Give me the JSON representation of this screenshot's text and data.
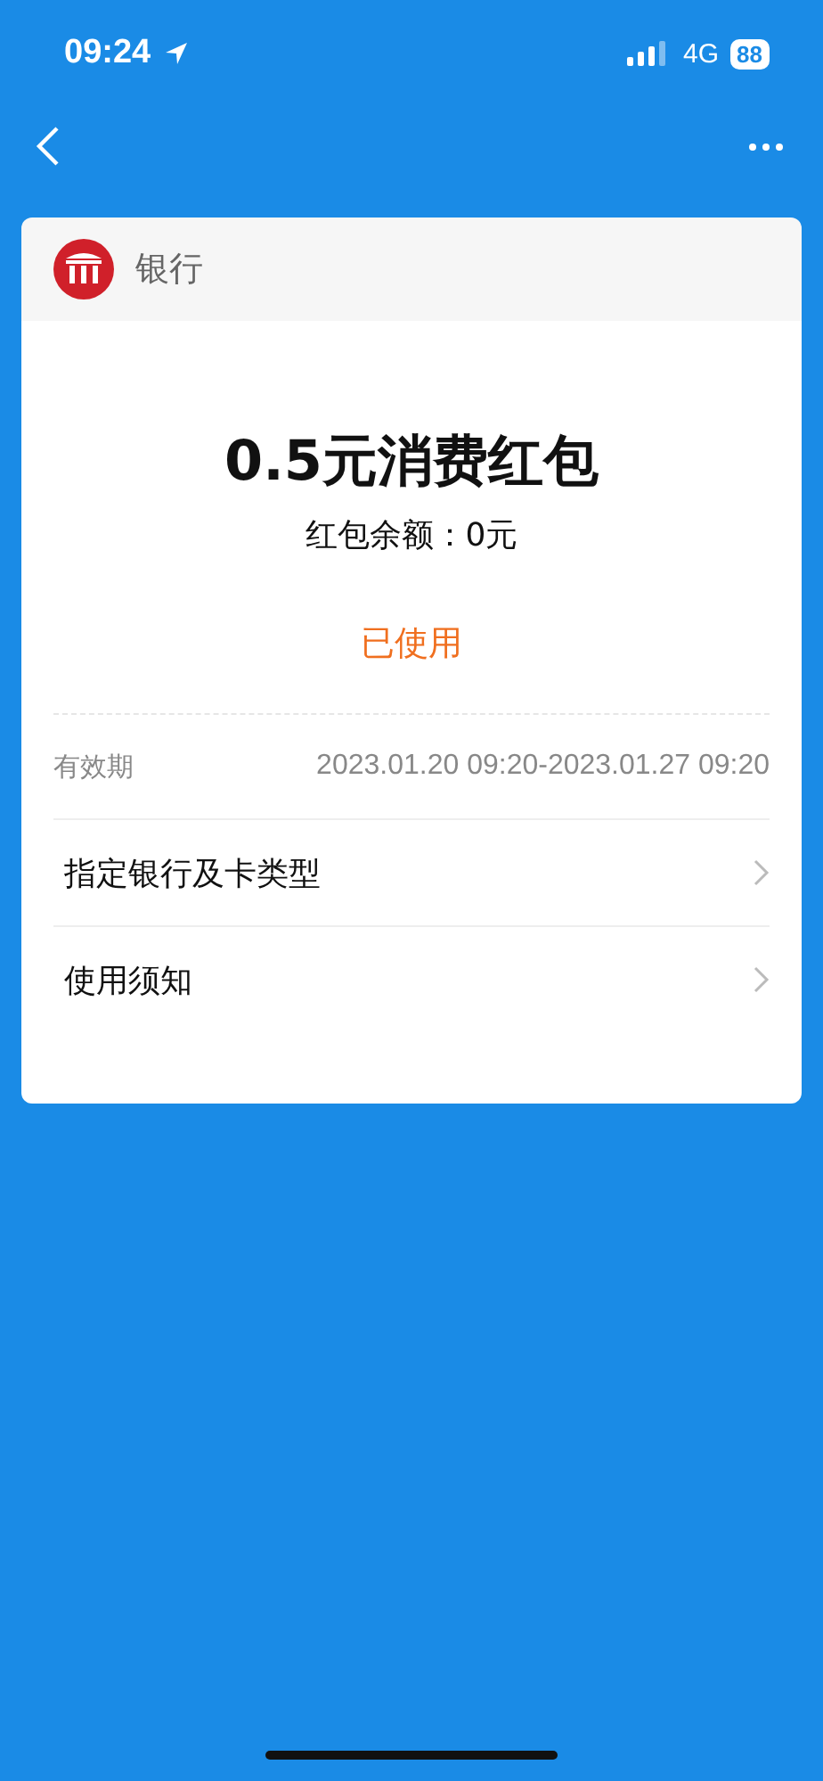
{
  "status_bar": {
    "time": "09:24",
    "network": "4G",
    "battery": "88"
  },
  "issuer": {
    "name": "银行"
  },
  "coupon": {
    "title": "0.5元消费红包",
    "balance": "红包余额：0元",
    "status": "已使用"
  },
  "validity": {
    "label": "有效期",
    "value": "2023.01.20 09:20-2023.01.27 09:20"
  },
  "links": [
    {
      "label": "指定银行及卡类型"
    },
    {
      "label": "使用须知"
    }
  ]
}
